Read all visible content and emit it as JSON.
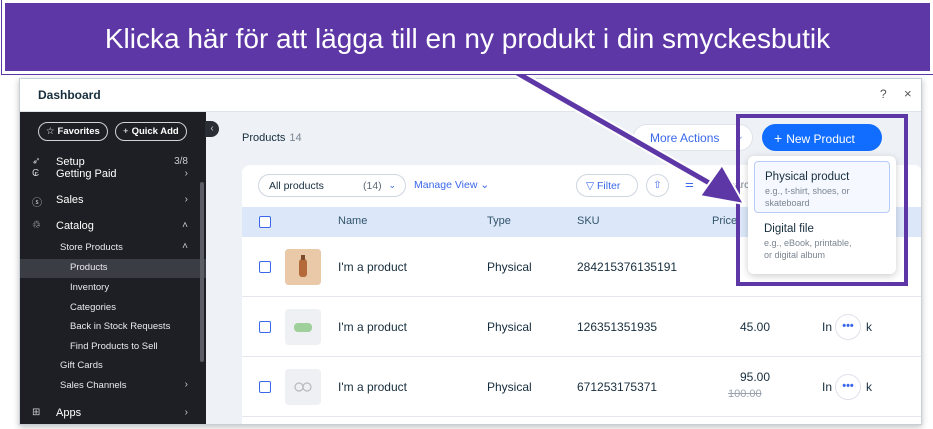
{
  "annotation": {
    "banner_text": "Klicka här för att lägga till en ny produkt i din smyckesbutik",
    "accent_color": "#5e37a6"
  },
  "window": {
    "title": "Dashboard",
    "help_icon": "?",
    "close_icon": "×"
  },
  "sidebar": {
    "favorites_label": "Favorites",
    "quick_add_label": "Quick Add",
    "items": [
      {
        "icon": "setup-icon",
        "label": "Setup",
        "right": "3/8"
      },
      {
        "icon": "getting-paid-icon",
        "label": "Getting Paid",
        "right": "›"
      },
      {
        "icon": "sales-icon",
        "label": "Sales",
        "right": "›"
      },
      {
        "icon": "catalog-icon",
        "label": "Catalog",
        "right": "˄"
      }
    ],
    "sub_items": [
      {
        "label": "Store Products",
        "right": "˄"
      },
      {
        "label": "Products",
        "right": ""
      },
      {
        "label": "Inventory",
        "right": ""
      },
      {
        "label": "Categories",
        "right": ""
      },
      {
        "label": "Back in Stock Requests",
        "right": ""
      },
      {
        "label": "Find Products to Sell",
        "right": ""
      },
      {
        "label": "Gift Cards",
        "right": ""
      },
      {
        "label": "Sales Channels",
        "right": "›"
      }
    ],
    "apps": {
      "icon": "apps-icon",
      "label": "Apps",
      "right": "›"
    }
  },
  "header": {
    "title": "Products",
    "count": "14",
    "more_actions_label": "More Actions",
    "new_product_label": "New Product"
  },
  "filters": {
    "view_label": "All products",
    "view_count": "(14)",
    "manage_view_label": "Manage View",
    "filter_label": "Filter",
    "search_placeholder": "Search..."
  },
  "table": {
    "columns": [
      "Name",
      "Type",
      "SKU",
      "Price"
    ],
    "rows": [
      {
        "name": "I'm a product",
        "type": "Physical",
        "sku": "284215376135191",
        "price": "",
        "price_old": "",
        "stock": ""
      },
      {
        "name": "I'm a product",
        "type": "Physical",
        "sku": "126351351935",
        "price": "45.00",
        "price_old": "",
        "stock": "In"
      },
      {
        "name": "I'm a product",
        "type": "Physical",
        "sku": "671253175371",
        "price": "95.00",
        "price_old": "100.00",
        "stock": "In"
      }
    ],
    "row_more_label": "•••",
    "stock_suffix": "k"
  },
  "dropdown": {
    "items": [
      {
        "title": "Physical product",
        "desc": "e.g., t-shirt, shoes, or\nskateboard"
      },
      {
        "title": "Digital file",
        "desc": "e.g., eBook, printable,\nor digital album"
      }
    ]
  }
}
